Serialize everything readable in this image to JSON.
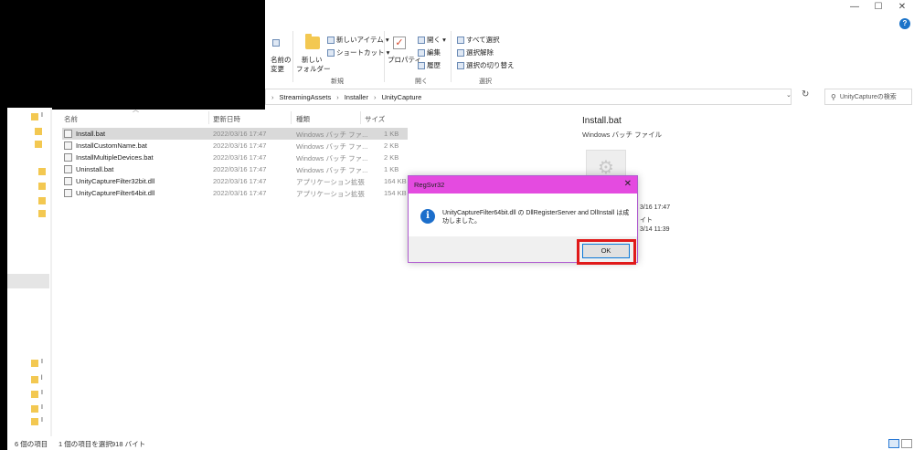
{
  "window": {
    "controls": {
      "minimize": "—",
      "maximize": "☐",
      "close": "✕"
    },
    "help": "?"
  },
  "ribbon": {
    "frag_label_1": "名前の",
    "frag_label_2": "変更",
    "new_folder_1": "新しい",
    "new_folder_2": "フォルダー",
    "new_item": "新しいアイテム ▾",
    "shortcut": "ショートカット ▾",
    "group_new": "新規",
    "properties": "プロパティ",
    "open": "開く ▾",
    "edit": "編集",
    "history": "履歴",
    "group_open": "開く",
    "select_all": "すべて選択",
    "select_none": "選択解除",
    "invert_selection": "選択の切り替え",
    "group_select": "選択"
  },
  "address": {
    "crumbs": [
      "StreamingAssets",
      "Installer",
      "UnityCapture"
    ],
    "separator": "›",
    "search_placeholder": "UnityCaptureの検索"
  },
  "columns": {
    "name": "名前",
    "date": "更新日時",
    "type": "種類",
    "size": "サイズ"
  },
  "files": [
    {
      "name": "Install.bat",
      "date": "2022/03/16 17:47",
      "type": "Windows バッチ ファ...",
      "size": "1 KB",
      "selected": true
    },
    {
      "name": "InstallCustomName.bat",
      "date": "2022/03/16 17:47",
      "type": "Windows バッチ ファ...",
      "size": "2 KB",
      "selected": false
    },
    {
      "name": "InstallMultipleDevices.bat",
      "date": "2022/03/16 17:47",
      "type": "Windows バッチ ファ...",
      "size": "2 KB",
      "selected": false
    },
    {
      "name": "Uninstall.bat",
      "date": "2022/03/16 17:47",
      "type": "Windows バッチ ファ...",
      "size": "1 KB",
      "selected": false
    },
    {
      "name": "UnityCaptureFilter32bit.dll",
      "date": "2022/03/16 17:47",
      "type": "アプリケーション拡張",
      "size": "164 KB",
      "selected": false
    },
    {
      "name": "UnityCaptureFilter64bit.dll",
      "date": "2022/03/16 17:47",
      "type": "アプリケーション拡張",
      "size": "154 KB",
      "selected": false
    }
  ],
  "preview": {
    "name": "Install.bat",
    "type": "Windows バッチ ファイル",
    "detail1": "3/16 17:47",
    "detail2": "イト",
    "detail3": "3/14 11:39"
  },
  "dialog": {
    "title": "RegSvr32",
    "close": "✕",
    "icon": "i",
    "message": "UnityCaptureFilter64bit.dll の DllRegisterServer and DllInstall は成功しました。",
    "ok_label": "OK",
    "highlight_color": "#e01a1a",
    "titlebar_color": "#e44be0"
  },
  "status": {
    "count": "6 個の項目",
    "selected": "1 個の項目を選択",
    "size": "918 バイト"
  },
  "nav": {
    "letters": [
      "I",
      "l",
      "I",
      "I",
      "I",
      "I"
    ]
  }
}
